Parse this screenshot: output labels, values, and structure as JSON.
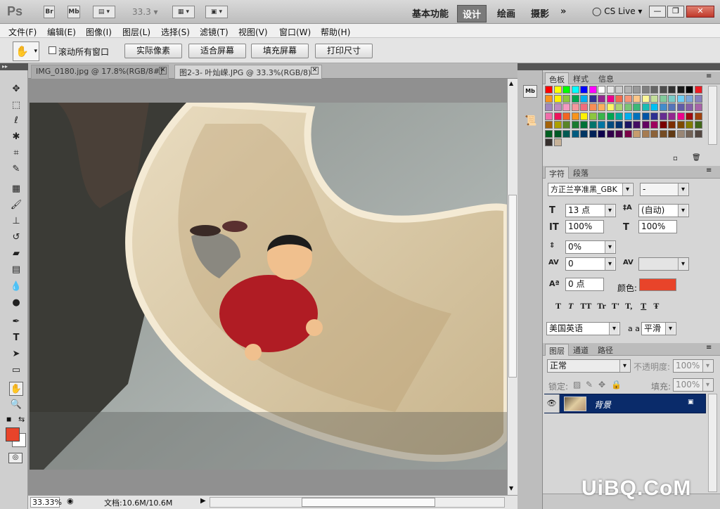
{
  "app": {
    "logo": "Ps",
    "zoom_box": "33.3",
    "logo_br": "Br",
    "logo_mb": "Mb"
  },
  "workspaces": [
    "基本功能",
    "设计",
    "绘画",
    "摄影"
  ],
  "cslive": "CS Live",
  "menu": [
    "文件(F)",
    "编辑(E)",
    "图像(I)",
    "图层(L)",
    "选择(S)",
    "滤镜(T)",
    "视图(V)",
    "窗口(W)",
    "帮助(H)"
  ],
  "options": {
    "scroll_all": "滚动所有窗口",
    "buttons": [
      "实际像素",
      "适合屏幕",
      "填充屏幕",
      "打印尺寸"
    ]
  },
  "tabs": [
    {
      "label": "IMG_0180.jpg @ 17.8%(RGB/8#)"
    },
    {
      "label": "图2-3- 叶灿嵘.JPG @ 33.3%(RGB/8)"
    }
  ],
  "status": {
    "zoom": "33.33%",
    "doc": "文档:10.6M/10.6M"
  },
  "panels": {
    "color_tabs": [
      "色板",
      "样式",
      "信息"
    ],
    "char_tabs": [
      "字符",
      "段落"
    ],
    "font": "方正兰亭准黑_GBK",
    "style": "-",
    "size": "13 点",
    "leading": "(自动)",
    "vscale": "100%",
    "hscale": "100%",
    "tracking_ratio": "0%",
    "kerning": "0",
    "tracking": "",
    "baseline": "0 点",
    "color_label": "颜色:",
    "text_color": "#e8442a",
    "lang": "美国英语",
    "aa_label": "a a",
    "aa": "平滑",
    "typo": [
      "T",
      "T",
      "TT",
      "Tr",
      "T'",
      "T,",
      "T",
      "Ŧ"
    ],
    "layer_tabs": [
      "图层",
      "通道",
      "路径"
    ],
    "blend": "正常",
    "opacity_label": "不透明度:",
    "opacity": "100%",
    "lock_label": "锁定:",
    "fill_label": "填充:",
    "fill": "100%",
    "layer_name": "背景"
  },
  "watermark": "UiBQ.CoM",
  "swatches": [
    "#ff0000",
    "#ffff00",
    "#00ff00",
    "#00ffff",
    "#0000ff",
    "#ff00ff",
    "#ffffff",
    "#e6e6e6",
    "#cccccc",
    "#b3b3b3",
    "#999999",
    "#808080",
    "#666666",
    "#4d4d4d",
    "#333333",
    "#1a1a1a",
    "#000000",
    "#ed1c24",
    "#f7941d",
    "#fff200",
    "#8dc63f",
    "#00a651",
    "#00aeef",
    "#2e3192",
    "#92278f",
    "#ec008c",
    "#f26c4f",
    "#f69679",
    "#fdc689",
    "#fff799",
    "#c4df9b",
    "#82ca9c",
    "#7accc8",
    "#6dcff6",
    "#7da7d9",
    "#8781bd",
    "#a186be",
    "#bd8cbf",
    "#f49ac1",
    "#f5989d",
    "#f26d7d",
    "#f68e56",
    "#fbaf5d",
    "#fff568",
    "#acd372",
    "#7cc576",
    "#3bb878",
    "#1abbb4",
    "#00bff3",
    "#438ccb",
    "#5574b9",
    "#605ca8",
    "#855fa8",
    "#a763a8",
    "#f06eaa",
    "#ed145b",
    "#f26522",
    "#f7941d",
    "#fff200",
    "#8dc63f",
    "#39b54a",
    "#00a651",
    "#00a99d",
    "#00aeef",
    "#0072bc",
    "#0054a6",
    "#2e3192",
    "#662d91",
    "#92278f",
    "#ec008c",
    "#9e0b0f",
    "#a0410d",
    "#a36209",
    "#aba000",
    "#598527",
    "#1a7b30",
    "#007236",
    "#00746b",
    "#0076a3",
    "#004b80",
    "#003471",
    "#1b1464",
    "#440e62",
    "#630460",
    "#9e005d",
    "#790000",
    "#7b2e00",
    "#7d4900",
    "#827b00",
    "#406618",
    "#005e20",
    "#005826",
    "#005952",
    "#005b7f",
    "#003663",
    "#002157",
    "#0d004c",
    "#32004b",
    "#4b0049",
    "#7b0046",
    "#c69c6d",
    "#a67c52",
    "#8c6239",
    "#754c24",
    "#603913",
    "#998675",
    "#736357",
    "#534741",
    "#362f2d",
    "#c7b299"
  ]
}
